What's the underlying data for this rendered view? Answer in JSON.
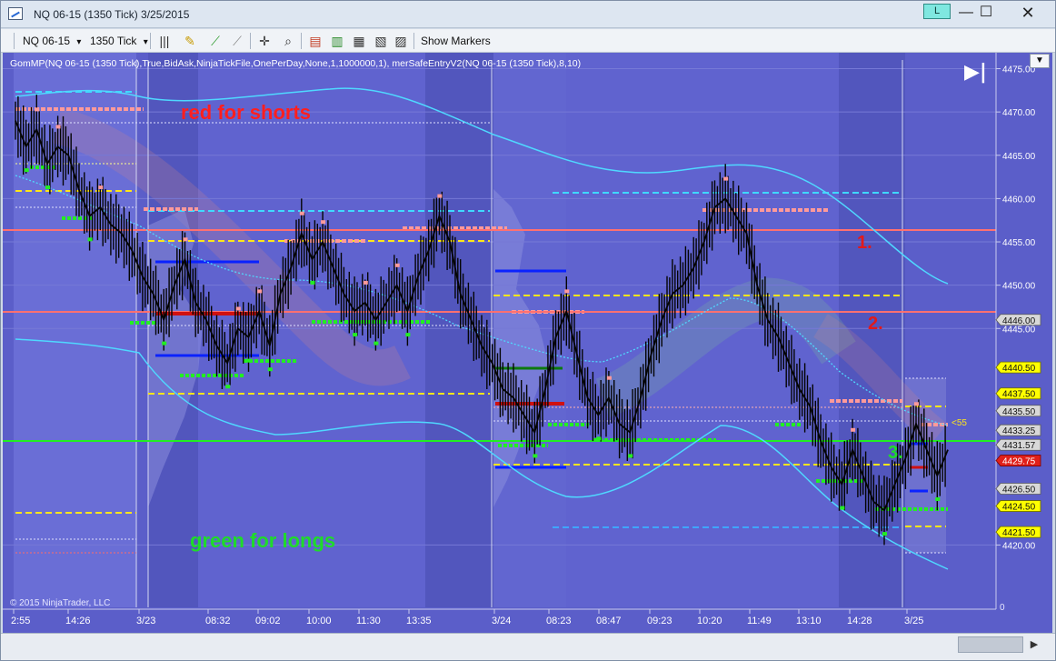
{
  "window": {
    "title": "NQ 06-15 (1350 Tick)  3/25/2015",
    "link_label": "L",
    "minimize": "—",
    "maximize": "☐",
    "close": "✕"
  },
  "toolbar": {
    "instrument": "NQ 06-15",
    "interval": "1350 Tick",
    "show_markers": "Show Markers",
    "dropdown_glyph": "▾"
  },
  "chart": {
    "indicator_label": "GomMP(NQ 06-15 (1350 Tick),True,BidAsk,NinjaTickFile,OnePerDay,None,1,1000000,1), merSafeEntryV2(NQ 06-15 (1350 Tick),8,10)",
    "copyright": "© 2015 NinjaTrader, LLC",
    "menu_glyph": "▼",
    "play_glyph": "▶|",
    "zero_label": "0",
    "annotations": {
      "shorts": "red for shorts",
      "longs": "green for longs",
      "marker_1": "1.",
      "marker_2": "2.",
      "marker_3": "3.",
      "marker_55": "<55"
    },
    "colors": {
      "background": "#5b5ec9",
      "shorts_text": "#ff1f1f",
      "longs_text": "#1fdb2a",
      "markers_text": "#e21a1a"
    }
  },
  "chart_data": {
    "type": "line",
    "instrument": "NQ 06-15",
    "y_axis": {
      "ticks": [
        "4475.00",
        "4470.00",
        "4465.00",
        "4460.00",
        "4455.00",
        "4450.00",
        "4445.00",
        "4420.00"
      ],
      "range": [
        4417,
        4476
      ]
    },
    "price_labels": [
      {
        "value": "4446.00",
        "style": "gray"
      },
      {
        "value": "4440.50",
        "style": "yellow"
      },
      {
        "value": "4437.50",
        "style": "yellow"
      },
      {
        "value": "4435.50",
        "style": "gray"
      },
      {
        "value": "4433.25",
        "style": "gray"
      },
      {
        "value": "4431.57",
        "style": "gray"
      },
      {
        "value": "4429.75",
        "style": "red"
      },
      {
        "value": "4426.50",
        "style": "gray"
      },
      {
        "value": "4424.50",
        "style": "yellow"
      },
      {
        "value": "4421.50",
        "style": "yellow"
      }
    ],
    "x_axis": {
      "ticks": [
        "2:55",
        "14:26",
        "3/23",
        "08:32",
        "09:02",
        "10:00",
        "11:30",
        "13:35",
        "3/24",
        "08:23",
        "08:47",
        "09:23",
        "10:20",
        "11:49",
        "13:10",
        "14:28",
        "3/25"
      ]
    },
    "price_series": [
      4469,
      4466,
      4468,
      4464,
      4466,
      4465,
      4461,
      4458,
      4459,
      4457,
      4456,
      4454,
      4451,
      4449,
      4446,
      4450,
      4453,
      4448,
      4446,
      4443,
      4441,
      4445,
      4444,
      4447,
      4443,
      4449,
      4452,
      4456,
      4453,
      4455,
      4452,
      4449,
      4447,
      4448,
      4446,
      4448,
      4450,
      4447,
      4451,
      4454,
      4458,
      4455,
      4449,
      4446,
      4443,
      4441,
      4438,
      4437,
      4435,
      4433,
      4438,
      4444,
      4447,
      4442,
      4437,
      4435,
      4437,
      4434,
      4433,
      4437,
      4442,
      4446,
      4449,
      4450,
      4452,
      4455,
      4459,
      4460,
      4458,
      4456,
      4450,
      4446,
      4444,
      4441,
      4438,
      4436,
      4432,
      4429,
      4427,
      4431,
      4428,
      4425,
      4424,
      4427,
      4430,
      4434,
      4431,
      4428,
      4431
    ],
    "levels": [
      {
        "value": 4457,
        "kind": "red-line"
      },
      {
        "value": 4448,
        "kind": "red-line"
      },
      {
        "value": 4433.25,
        "kind": "green-line"
      }
    ]
  }
}
